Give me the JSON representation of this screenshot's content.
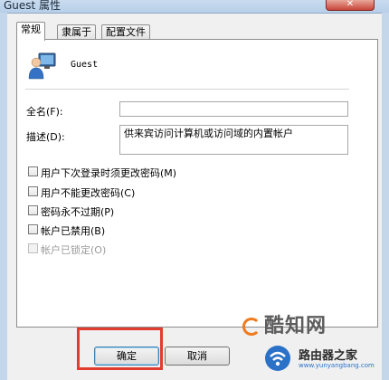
{
  "window": {
    "title": "Guest 属性",
    "close_glyph": "✕"
  },
  "tabs": [
    {
      "label": "常规",
      "active": true
    },
    {
      "label": "隶属于",
      "active": false
    },
    {
      "label": "配置文件",
      "active": false
    }
  ],
  "general": {
    "username": "Guest",
    "fullname_label": "全名(F):",
    "fullname_value": "",
    "description_label": "描述(D):",
    "description_value": "供来宾访问计算机或访问域的内置帐户",
    "checkboxes": [
      {
        "label": "用户下次登录时须更改密码(M)",
        "checked": false,
        "disabled": false
      },
      {
        "label": "用户不能更改密码(C)",
        "checked": false,
        "disabled": false
      },
      {
        "label": "密码永不过期(P)",
        "checked": false,
        "disabled": false
      },
      {
        "label": "帐户已禁用(B)",
        "checked": false,
        "disabled": false
      },
      {
        "label": "帐户已锁定(O)",
        "checked": false,
        "disabled": true
      }
    ]
  },
  "buttons": {
    "ok": "确定",
    "cancel": "取消"
  },
  "watermarks": {
    "brand1": "酷知网",
    "brand2": "路由器之家",
    "brand2_url": "www.yunyangbang.com"
  },
  "colors": {
    "highlight": "#e23c2f",
    "title_bar": "#c4d6ea"
  }
}
